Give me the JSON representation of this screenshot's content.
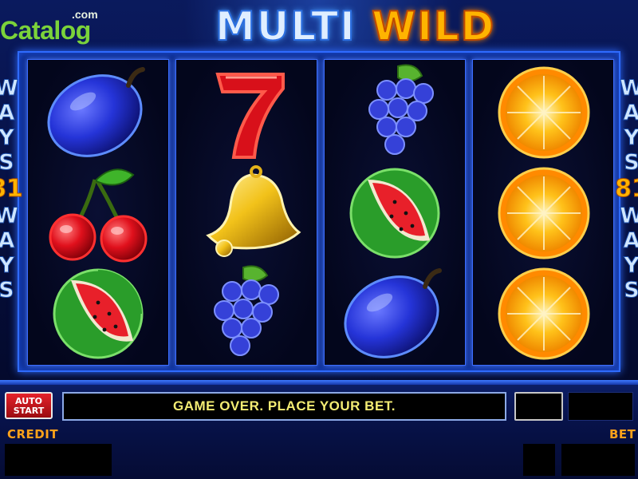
{
  "branding": {
    "logo_text": "Catalog",
    "logo_suffix": ".com"
  },
  "header": {
    "title_part1": "MULTI",
    "title_part2": "WILD"
  },
  "ways_indicator": {
    "word_letters": [
      "W",
      "A",
      "Y",
      "S"
    ],
    "number": "81"
  },
  "reels": [
    {
      "symbols": [
        "plum",
        "cherries",
        "watermelon"
      ]
    },
    {
      "symbols": [
        "seven",
        "bell",
        "grapes"
      ]
    },
    {
      "symbols": [
        "grapes",
        "watermelon",
        "plum"
      ]
    },
    {
      "symbols": [
        "orange",
        "orange",
        "orange"
      ]
    }
  ],
  "controls": {
    "autostart_line1": "AUTO",
    "autostart_line2": "START",
    "message": "GAME OVER. PLACE YOUR BET.",
    "credit_label": "CREDIT",
    "bet_label": "BET"
  },
  "colors": {
    "frame_blue": "#2f6bff",
    "message_text": "#f3ec73",
    "label_orange": "#ffa21a",
    "autostart_red": "#e5222a"
  }
}
